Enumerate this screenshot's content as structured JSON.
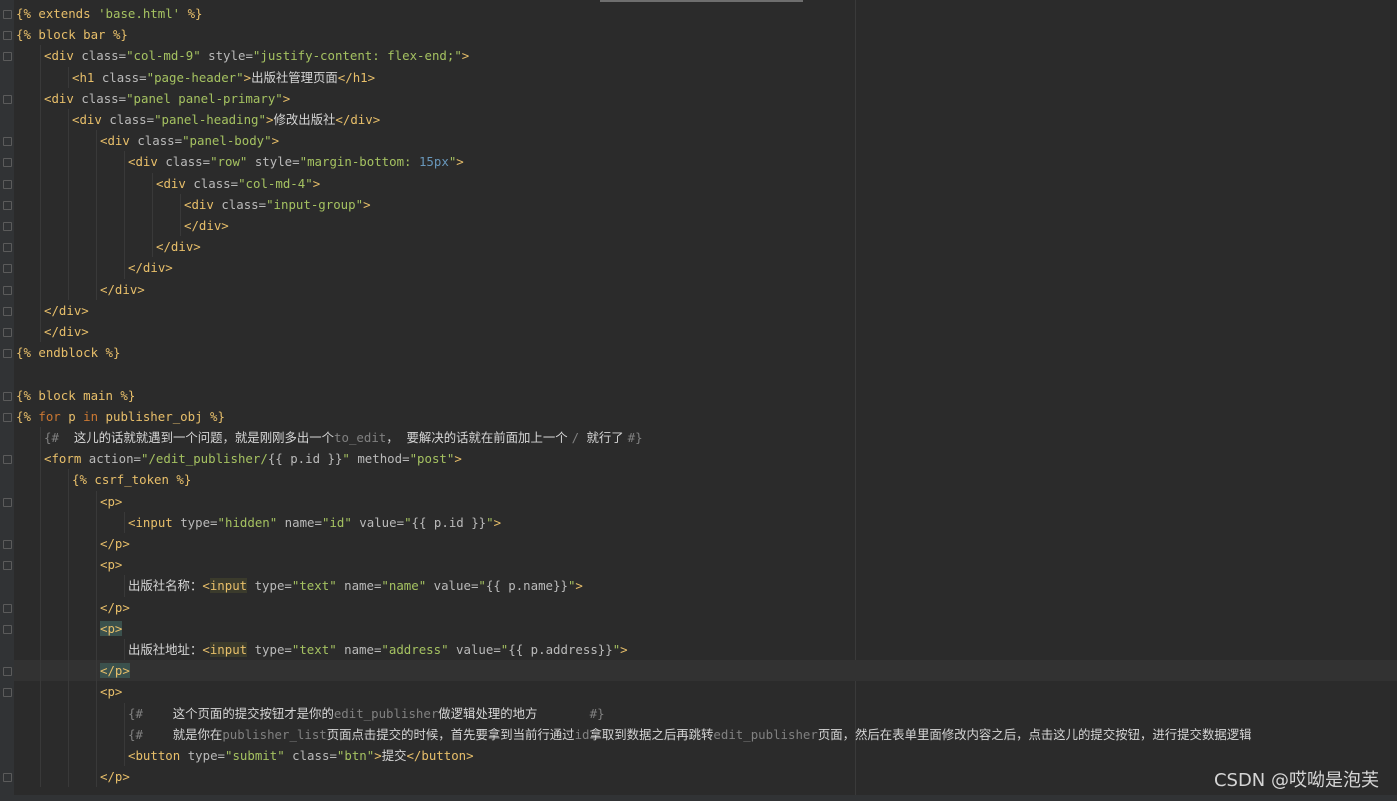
{
  "editor": {
    "lines": [
      {
        "indent": 0,
        "fold": true,
        "tokens": [
          {
            "text": "{% extends ",
            "cls": "t-tmpl"
          },
          {
            "text": "'base.html'",
            "cls": "t-str"
          },
          {
            "text": " %}",
            "cls": "t-tmpl"
          }
        ]
      },
      {
        "indent": 0,
        "fold": true,
        "tokens": [
          {
            "text": "{% block bar %}",
            "cls": "t-tmpl"
          }
        ]
      },
      {
        "indent": 1,
        "fold": true,
        "tokens": [
          {
            "text": "<div ",
            "cls": "t-tag"
          },
          {
            "text": "class=",
            "cls": "t-attr"
          },
          {
            "text": "\"col-md-9\" ",
            "cls": "t-str"
          },
          {
            "text": "style=",
            "cls": "t-attr"
          },
          {
            "text": "\"justify-content: ",
            "cls": "t-str"
          },
          {
            "text": "flex-end",
            "cls": "t-str"
          },
          {
            "text": ";\"",
            "cls": "t-str"
          },
          {
            "text": ">",
            "cls": "t-tag"
          }
        ]
      },
      {
        "indent": 2,
        "fold": false,
        "tokens": [
          {
            "text": "<h1 ",
            "cls": "t-tag"
          },
          {
            "text": "class=",
            "cls": "t-attr"
          },
          {
            "text": "\"page-header\"",
            "cls": "t-str"
          },
          {
            "text": ">",
            "cls": "t-tag"
          },
          {
            "text": "出版社管理页面",
            "cls": "t-cjk"
          },
          {
            "text": "</h1>",
            "cls": "t-tag"
          }
        ]
      },
      {
        "indent": 1,
        "fold": true,
        "tokens": [
          {
            "text": "<div ",
            "cls": "t-tag"
          },
          {
            "text": "class=",
            "cls": "t-attr"
          },
          {
            "text": "\"panel panel-primary\"",
            "cls": "t-str"
          },
          {
            "text": ">",
            "cls": "t-tag"
          }
        ]
      },
      {
        "indent": 2,
        "fold": false,
        "tokens": [
          {
            "text": "<div ",
            "cls": "t-tag"
          },
          {
            "text": "class=",
            "cls": "t-attr"
          },
          {
            "text": "\"panel-heading\"",
            "cls": "t-str"
          },
          {
            "text": ">",
            "cls": "t-tag"
          },
          {
            "text": "修改出版社",
            "cls": "t-cjk"
          },
          {
            "text": "</div>",
            "cls": "t-tag"
          }
        ]
      },
      {
        "indent": 3,
        "fold": true,
        "tokens": [
          {
            "text": "<div ",
            "cls": "t-tag"
          },
          {
            "text": "class=",
            "cls": "t-attr"
          },
          {
            "text": "\"panel-body\"",
            "cls": "t-str"
          },
          {
            "text": ">",
            "cls": "t-tag"
          }
        ]
      },
      {
        "indent": 4,
        "fold": true,
        "tokens": [
          {
            "text": "<div ",
            "cls": "t-tag"
          },
          {
            "text": "class=",
            "cls": "t-attr"
          },
          {
            "text": "\"row\" ",
            "cls": "t-str"
          },
          {
            "text": "style=",
            "cls": "t-attr"
          },
          {
            "text": "\"margin-bottom: ",
            "cls": "t-str"
          },
          {
            "text": "15px",
            "cls": "t-num"
          },
          {
            "text": "\"",
            "cls": "t-str"
          },
          {
            "text": ">",
            "cls": "t-tag"
          }
        ]
      },
      {
        "indent": 5,
        "fold": true,
        "tokens": [
          {
            "text": "<div ",
            "cls": "t-tag"
          },
          {
            "text": "class=",
            "cls": "t-attr"
          },
          {
            "text": "\"col-md-4\"",
            "cls": "t-str"
          },
          {
            "text": ">",
            "cls": "t-tag"
          }
        ]
      },
      {
        "indent": 6,
        "fold": true,
        "tokens": [
          {
            "text": "<div ",
            "cls": "t-tag"
          },
          {
            "text": "class=",
            "cls": "t-attr"
          },
          {
            "text": "\"input-group\"",
            "cls": "t-str"
          },
          {
            "text": ">",
            "cls": "t-tag"
          }
        ]
      },
      {
        "indent": 6,
        "fold": true,
        "tokens": [
          {
            "text": "</div>",
            "cls": "t-tag"
          }
        ]
      },
      {
        "indent": 5,
        "fold": true,
        "tokens": [
          {
            "text": "</div>",
            "cls": "t-tag"
          }
        ]
      },
      {
        "indent": 4,
        "fold": true,
        "tokens": [
          {
            "text": "</div>",
            "cls": "t-tag"
          }
        ]
      },
      {
        "indent": 3,
        "fold": true,
        "tokens": [
          {
            "text": "</div>",
            "cls": "t-tag"
          }
        ]
      },
      {
        "indent": 1,
        "fold": true,
        "tokens": [
          {
            "text": "</div>",
            "cls": "t-tag"
          }
        ]
      },
      {
        "indent": 1,
        "fold": true,
        "tokens": [
          {
            "text": "</div>",
            "cls": "t-tag"
          }
        ]
      },
      {
        "indent": 0,
        "fold": true,
        "tokens": [
          {
            "text": "{% endblock %}",
            "cls": "t-tmpl"
          }
        ]
      },
      {
        "indent": 0,
        "fold": false,
        "tokens": []
      },
      {
        "indent": 0,
        "fold": true,
        "tokens": [
          {
            "text": "{% block main %}",
            "cls": "t-tmpl"
          }
        ]
      },
      {
        "indent": 0,
        "fold": true,
        "tokens": [
          {
            "text": "{% ",
            "cls": "t-tmpl"
          },
          {
            "text": "for",
            "cls": "t-kw"
          },
          {
            "text": " p ",
            "cls": "t-tmpl"
          },
          {
            "text": "in",
            "cls": "t-kw"
          },
          {
            "text": " publisher_obj %}",
            "cls": "t-tmpl"
          }
        ]
      },
      {
        "indent": 1,
        "fold": false,
        "tokens": [
          {
            "text": "{#  ",
            "cls": "t-comment"
          },
          {
            "text": "这儿的话就就遇到一个问题，就是刚刚多出一个",
            "cls": "t-cjk"
          },
          {
            "text": "to_edit",
            "cls": "t-comment"
          },
          {
            "text": "，  要解决的话就在前面加上一个 ",
            "cls": "t-cjk"
          },
          {
            "text": "/ ",
            "cls": "t-comment"
          },
          {
            "text": "就行了 ",
            "cls": "t-cjk"
          },
          {
            "text": "#}",
            "cls": "t-comment"
          }
        ]
      },
      {
        "indent": 1,
        "fold": true,
        "tokens": [
          {
            "text": "<form ",
            "cls": "t-tag"
          },
          {
            "text": "action=",
            "cls": "t-attr"
          },
          {
            "text": "\"/edit_publisher/",
            "cls": "t-str"
          },
          {
            "text": "{{ p.id }}",
            "cls": "t-attr"
          },
          {
            "text": "\" ",
            "cls": "t-str"
          },
          {
            "text": "method=",
            "cls": "t-attr"
          },
          {
            "text": "\"post\"",
            "cls": "t-str"
          },
          {
            "text": ">",
            "cls": "t-tag"
          }
        ]
      },
      {
        "indent": 2,
        "fold": false,
        "tokens": [
          {
            "text": "{% csrf_token %}",
            "cls": "t-tmpl"
          }
        ]
      },
      {
        "indent": 3,
        "fold": true,
        "tokens": [
          {
            "text": "<p>",
            "cls": "t-tag"
          }
        ]
      },
      {
        "indent": 4,
        "fold": false,
        "tokens": [
          {
            "text": "<input ",
            "cls": "t-tag"
          },
          {
            "text": "type=",
            "cls": "t-attr"
          },
          {
            "text": "\"hidden\" ",
            "cls": "t-str"
          },
          {
            "text": "name=",
            "cls": "t-attr"
          },
          {
            "text": "\"id\" ",
            "cls": "t-str"
          },
          {
            "text": "value=",
            "cls": "t-attr"
          },
          {
            "text": "\"",
            "cls": "t-str"
          },
          {
            "text": "{{ p.id }}",
            "cls": "t-attr"
          },
          {
            "text": "\"",
            "cls": "t-str"
          },
          {
            "text": ">",
            "cls": "t-tag"
          }
        ]
      },
      {
        "indent": 3,
        "fold": true,
        "tokens": [
          {
            "text": "</p>",
            "cls": "t-tag"
          }
        ]
      },
      {
        "indent": 3,
        "fold": true,
        "tokens": [
          {
            "text": "<p>",
            "cls": "t-tag"
          }
        ]
      },
      {
        "indent": 4,
        "fold": false,
        "tokens": [
          {
            "text": "出版社名称：",
            "cls": "t-cjk"
          },
          {
            "text": "<",
            "cls": "t-tag"
          },
          {
            "text": "input",
            "cls": "t-tag hl-ident"
          },
          {
            "text": " type=",
            "cls": "t-attr"
          },
          {
            "text": "\"text\" ",
            "cls": "t-str"
          },
          {
            "text": "name=",
            "cls": "t-attr"
          },
          {
            "text": "\"name\" ",
            "cls": "t-str"
          },
          {
            "text": "value=",
            "cls": "t-attr"
          },
          {
            "text": "\"",
            "cls": "t-str"
          },
          {
            "text": "{{ p.name}}",
            "cls": "t-attr"
          },
          {
            "text": "\"",
            "cls": "t-str"
          },
          {
            "text": ">",
            "cls": "t-tag"
          }
        ]
      },
      {
        "indent": 3,
        "fold": true,
        "tokens": [
          {
            "text": "</p>",
            "cls": "t-tag"
          }
        ]
      },
      {
        "indent": 3,
        "fold": true,
        "tokens": [
          {
            "text": "<p>",
            "cls": "t-tag hl-brace"
          }
        ]
      },
      {
        "indent": 4,
        "fold": false,
        "tokens": [
          {
            "text": "出版社地址：",
            "cls": "t-cjk"
          },
          {
            "text": "<",
            "cls": "t-tag"
          },
          {
            "text": "input",
            "cls": "t-tag hl-ident"
          },
          {
            "text": " type=",
            "cls": "t-attr"
          },
          {
            "text": "\"text\" ",
            "cls": "t-str"
          },
          {
            "text": "name=",
            "cls": "t-attr"
          },
          {
            "text": "\"address\" ",
            "cls": "t-str"
          },
          {
            "text": "value=",
            "cls": "t-attr"
          },
          {
            "text": "\"",
            "cls": "t-str"
          },
          {
            "text": "{{ p.address}}",
            "cls": "t-attr"
          },
          {
            "text": "\"",
            "cls": "t-str"
          },
          {
            "text": ">",
            "cls": "t-tag"
          }
        ]
      },
      {
        "indent": 3,
        "fold": true,
        "current": true,
        "tokens": [
          {
            "text": "</p>",
            "cls": "t-tag hl-brace"
          }
        ]
      },
      {
        "indent": 3,
        "fold": true,
        "tokens": [
          {
            "text": "<p>",
            "cls": "t-tag"
          }
        ]
      },
      {
        "indent": 4,
        "fold": false,
        "tokens": [
          {
            "text": "{#    ",
            "cls": "t-comment"
          },
          {
            "text": "这个页面的提交按钮才是你的",
            "cls": "t-cjk"
          },
          {
            "text": "edit_publisher",
            "cls": "t-comment"
          },
          {
            "text": "做逻辑处理的地方",
            "cls": "t-cjk"
          },
          {
            "text": "       #}",
            "cls": "t-comment"
          }
        ]
      },
      {
        "indent": 4,
        "fold": false,
        "tokens": [
          {
            "text": "{#    ",
            "cls": "t-comment"
          },
          {
            "text": "就是你在",
            "cls": "t-cjk"
          },
          {
            "text": "publisher_list",
            "cls": "t-comment"
          },
          {
            "text": "页面点击提交的时候，首先要拿到当前行通过",
            "cls": "t-cjk"
          },
          {
            "text": "id",
            "cls": "t-comment"
          },
          {
            "text": "拿取到数据之后再跳转",
            "cls": "t-cjk"
          },
          {
            "text": "edit_publisher",
            "cls": "t-comment"
          },
          {
            "text": "页面，然后在表单里面修改内容之后，点击这儿的提交按钮，进行提交数据逻辑",
            "cls": "t-cjk"
          }
        ]
      },
      {
        "indent": 4,
        "fold": false,
        "tokens": [
          {
            "text": "<button ",
            "cls": "t-tag"
          },
          {
            "text": "type=",
            "cls": "t-attr"
          },
          {
            "text": "\"submit\" ",
            "cls": "t-str"
          },
          {
            "text": "class=",
            "cls": "t-attr"
          },
          {
            "text": "\"btn\"",
            "cls": "t-str"
          },
          {
            "text": ">",
            "cls": "t-tag"
          },
          {
            "text": "提交",
            "cls": "t-cjk"
          },
          {
            "text": "</button>",
            "cls": "t-tag"
          }
        ]
      },
      {
        "indent": 3,
        "fold": true,
        "tokens": [
          {
            "text": "</p>",
            "cls": "t-tag"
          }
        ]
      }
    ]
  },
  "watermark": "CSDN @哎呦是泡芙"
}
